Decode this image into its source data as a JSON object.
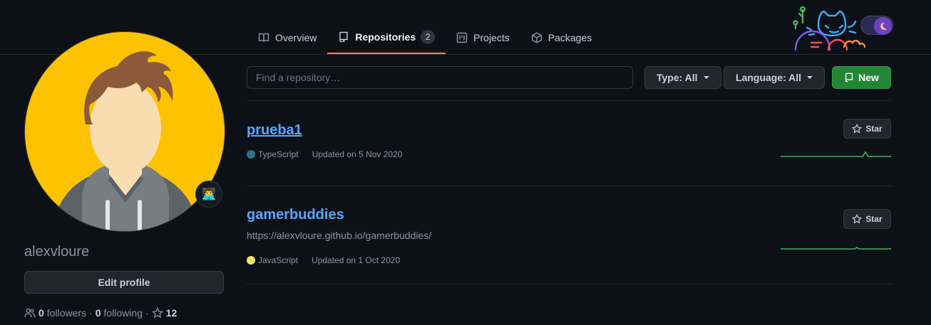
{
  "nav": {
    "tabs": [
      {
        "label": "Overview",
        "icon": "book-icon"
      },
      {
        "label": "Repositories",
        "icon": "repo-icon",
        "count": "2",
        "active": true
      },
      {
        "label": "Projects",
        "icon": "project-icon"
      },
      {
        "label": "Packages",
        "icon": "package-icon"
      }
    ]
  },
  "profile": {
    "username": "alexvloure",
    "edit_label": "Edit profile",
    "status_emoji": "👨‍💻",
    "followers_count": "0",
    "followers_label": "followers",
    "separator": "·",
    "following_count": "0",
    "following_label": "following",
    "stars_count": "12"
  },
  "filters": {
    "search_placeholder": "Find a repository…",
    "type_label": "Type: All",
    "language_label": "Language: All",
    "new_label": "New"
  },
  "repos": [
    {
      "name": "prueba1",
      "description": "",
      "language": "TypeScript",
      "language_color": "#2b7489",
      "updated": "Updated on 5 Nov 2020",
      "star_label": "Star"
    },
    {
      "name": "gamerbuddies",
      "description": "https://alexvloure.github.io/gamerbuddies/",
      "language": "JavaScript",
      "language_color": "#f1e05a",
      "updated": "Updated on 1 Oct 2020",
      "star_label": "Star"
    }
  ],
  "colors": {
    "accent": "#f78166",
    "link": "#58a6ff",
    "primary_button": "#238636",
    "avatar_background": "#fdc300",
    "sparkline": "#56d364"
  }
}
